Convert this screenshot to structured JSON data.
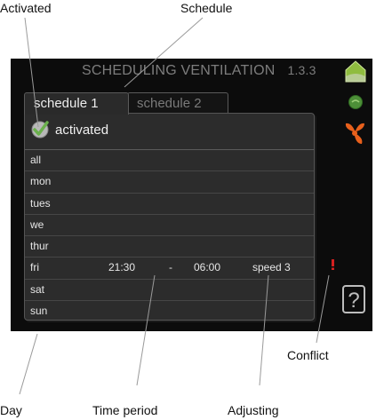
{
  "callouts": {
    "activated": "Activated",
    "schedule": "Schedule",
    "conflict": "Conflict",
    "day": "Day",
    "time_period": "Time period",
    "adjusting": "Adjusting"
  },
  "header": {
    "title": "SCHEDULING VENTILATION",
    "menu_code": "1.3.3"
  },
  "tabs": [
    {
      "label": "schedule 1",
      "active": true
    },
    {
      "label": "schedule 2",
      "active": false
    }
  ],
  "activated_checkbox": {
    "label": "activated",
    "checked": true
  },
  "schedule_rows": [
    {
      "day": "all",
      "start": "",
      "separator": "",
      "end": "",
      "adjusting": ""
    },
    {
      "day": "mon",
      "start": "",
      "separator": "",
      "end": "",
      "adjusting": ""
    },
    {
      "day": "tues",
      "start": "",
      "separator": "",
      "end": "",
      "adjusting": ""
    },
    {
      "day": "we",
      "start": "",
      "separator": "",
      "end": "",
      "adjusting": ""
    },
    {
      "day": "thur",
      "start": "",
      "separator": "",
      "end": "",
      "adjusting": ""
    },
    {
      "day": "fri",
      "start": "21:30",
      "separator": "-",
      "end": "06:00",
      "adjusting": "speed 3"
    },
    {
      "day": "sat",
      "start": "",
      "separator": "",
      "end": "",
      "adjusting": ""
    },
    {
      "day": "sun",
      "start": "",
      "separator": "",
      "end": "",
      "adjusting": ""
    }
  ],
  "side_icons": [
    "house-icon",
    "status-dot-icon",
    "fan-icon",
    "conflict-icon",
    "help-icon"
  ],
  "help_label": "?",
  "colors": {
    "screen_bg": "#0c0c0c",
    "panel_bg": "#2c2c2c",
    "check_green": "#6ab04c",
    "fan_orange": "#e8601c",
    "conflict_red": "#d42020"
  }
}
